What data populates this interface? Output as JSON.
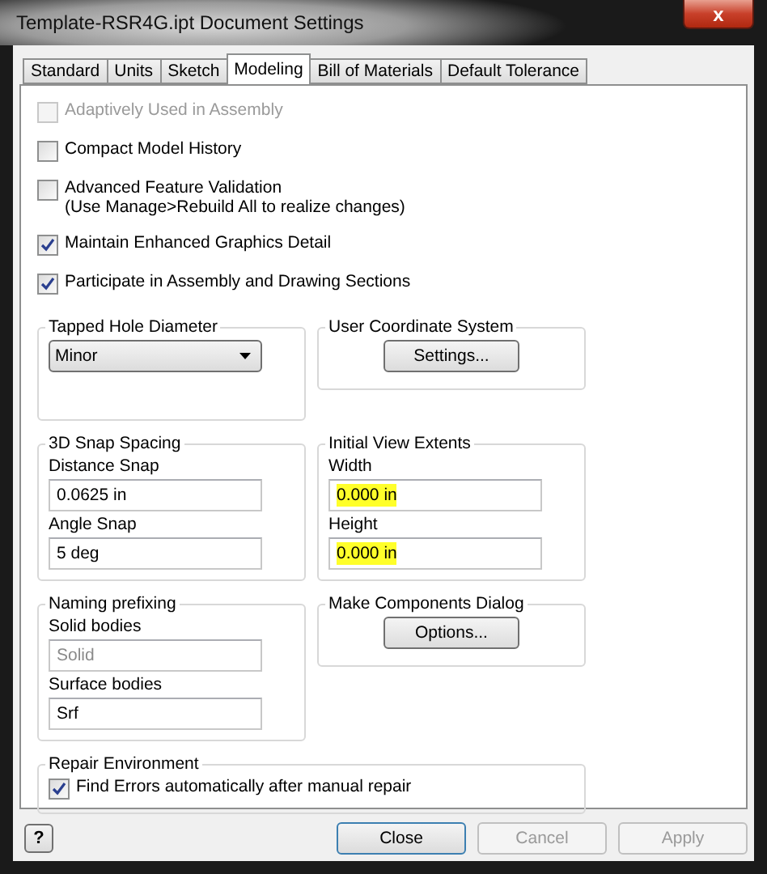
{
  "window": {
    "title": "Template-RSR4G.ipt Document Settings",
    "close": "x"
  },
  "tabs": [
    {
      "label": "Standard",
      "selected": false
    },
    {
      "label": "Units",
      "selected": false
    },
    {
      "label": "Sketch",
      "selected": false
    },
    {
      "label": "Modeling",
      "selected": true
    },
    {
      "label": "Bill of Materials",
      "selected": false
    },
    {
      "label": "Default Tolerance",
      "selected": false
    }
  ],
  "options": [
    {
      "label": "Adaptively Used in Assembly",
      "checked": false,
      "disabled": true
    },
    {
      "label": "Compact Model History",
      "checked": false,
      "disabled": false
    },
    {
      "label": "Advanced Feature Validation",
      "note": "(Use Manage>Rebuild All to realize changes)",
      "checked": false,
      "disabled": false
    },
    {
      "label": "Maintain Enhanced Graphics Detail",
      "checked": true,
      "disabled": false
    },
    {
      "label": "Participate in Assembly and Drawing Sections",
      "checked": true,
      "disabled": false
    }
  ],
  "group_rows": [
    [
      {
        "title": "Tapped Hole Diameter",
        "kind": "dropdown",
        "value": "Minor"
      },
      {
        "title": "User Coordinate System",
        "kind": "button",
        "button": "Settings..."
      }
    ],
    [
      {
        "title": "3D Snap Spacing",
        "kind": "fields",
        "fields": [
          {
            "label": "Distance Snap",
            "value": "0.0625 in",
            "disabled": false,
            "highlighted": false
          },
          {
            "label": "Angle Snap",
            "value": "5 deg",
            "disabled": false,
            "highlighted": false
          }
        ]
      },
      {
        "title": "Initial View Extents",
        "kind": "fields",
        "fields": [
          {
            "label": "Width",
            "value": "0.000 in",
            "disabled": false,
            "highlighted": true
          },
          {
            "label": "Height",
            "value": "0.000 in",
            "disabled": false,
            "highlighted": true
          }
        ]
      }
    ],
    [
      {
        "title": "Naming prefixing",
        "kind": "fields",
        "fields": [
          {
            "label": "Solid bodies",
            "value": "Solid",
            "disabled": true,
            "highlighted": false
          },
          {
            "label": "Surface bodies",
            "value": "Srf",
            "disabled": false,
            "highlighted": false
          }
        ]
      },
      {
        "title": "Make Components Dialog",
        "kind": "button",
        "button": "Options..."
      }
    ],
    [
      {
        "title": "Repair Environment",
        "kind": "checkbox",
        "label": "Find Errors automatically after manual repair",
        "checked": true
      }
    ]
  ],
  "footer": {
    "help": "?",
    "buttons": [
      {
        "label": "Close",
        "disabled": false,
        "default": true
      },
      {
        "label": "Cancel",
        "disabled": true,
        "default": false
      },
      {
        "label": "Apply",
        "disabled": true,
        "default": false
      }
    ]
  }
}
